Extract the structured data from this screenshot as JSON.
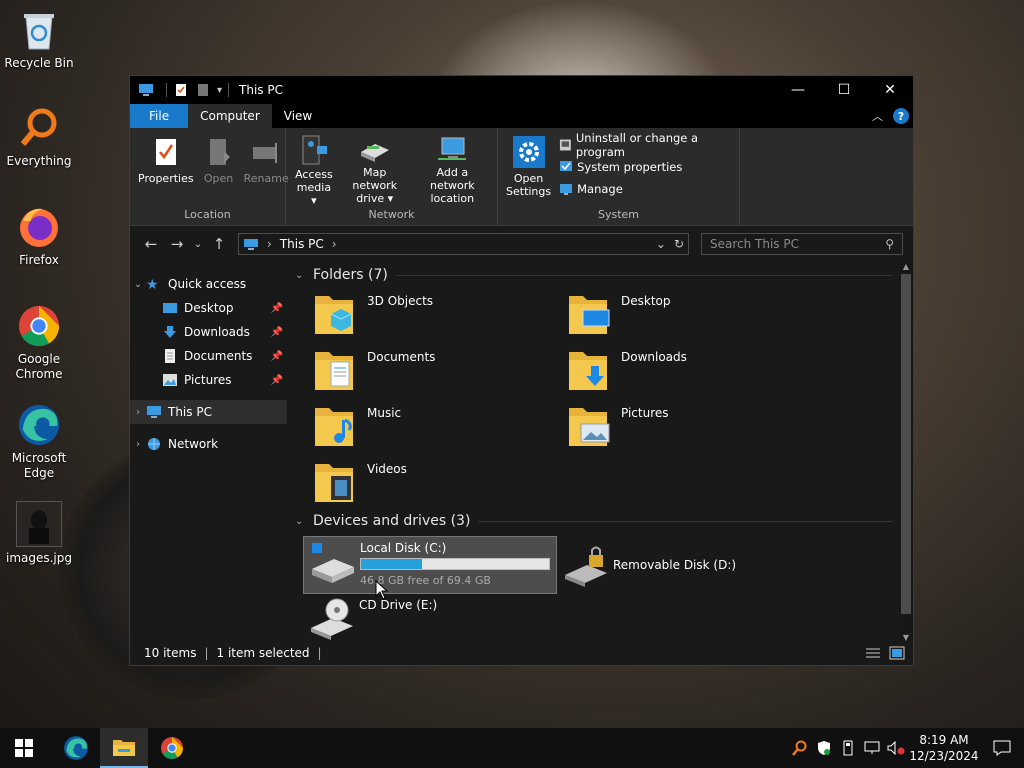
{
  "desktop": {
    "icons": [
      {
        "label": "Recycle Bin"
      },
      {
        "label": "Everything"
      },
      {
        "label": "Firefox"
      },
      {
        "label": "Google Chrome"
      },
      {
        "label": "Microsoft Edge"
      },
      {
        "label": "images.jpg"
      }
    ]
  },
  "window": {
    "title": "This PC",
    "controls": {
      "minimize": "—",
      "maximize": "☐",
      "close": "✕"
    }
  },
  "ribbon": {
    "tabs": {
      "file": "File",
      "computer": "Computer",
      "view": "View"
    },
    "location": {
      "label": "Location",
      "properties": "Properties",
      "open": "Open",
      "rename": "Rename"
    },
    "network": {
      "label": "Network",
      "access_media_1": "Access",
      "access_media_2": "media ▾",
      "map_drive_1": "Map network",
      "map_drive_2": "drive ▾",
      "add_location_1": "Add a network",
      "add_location_2": "location"
    },
    "system": {
      "label": "System",
      "open_settings_1": "Open",
      "open_settings_2": "Settings",
      "uninstall": "Uninstall or change a program",
      "system_properties": "System properties",
      "manage": "Manage"
    }
  },
  "address": {
    "path": "This PC",
    "search_placeholder": "Search This PC"
  },
  "nav": {
    "quick_access": "Quick access",
    "desktop": "Desktop",
    "downloads": "Downloads",
    "documents": "Documents",
    "pictures": "Pictures",
    "this_pc": "This PC",
    "network": "Network"
  },
  "content": {
    "folders_header": "Folders (7)",
    "folders": [
      {
        "name": "3D Objects"
      },
      {
        "name": "Desktop"
      },
      {
        "name": "Documents"
      },
      {
        "name": "Downloads"
      },
      {
        "name": "Music"
      },
      {
        "name": "Pictures"
      },
      {
        "name": "Videos"
      }
    ],
    "devices_header": "Devices and drives (3)",
    "drives": [
      {
        "name": "Local Disk (C:)",
        "free": "46.8 GB free of 69.4 GB",
        "used_fraction": 0.326
      },
      {
        "name": "Removable Disk (D:)"
      },
      {
        "name": "CD Drive (E:)"
      }
    ]
  },
  "status": {
    "items": "10 items",
    "selected": "1 item selected"
  },
  "taskbar": {
    "time": "8:19 AM",
    "date": "12/23/2024"
  },
  "colors": {
    "accent": "#1979ca",
    "progress": "#26a0da",
    "folder": "#f3c84d"
  }
}
